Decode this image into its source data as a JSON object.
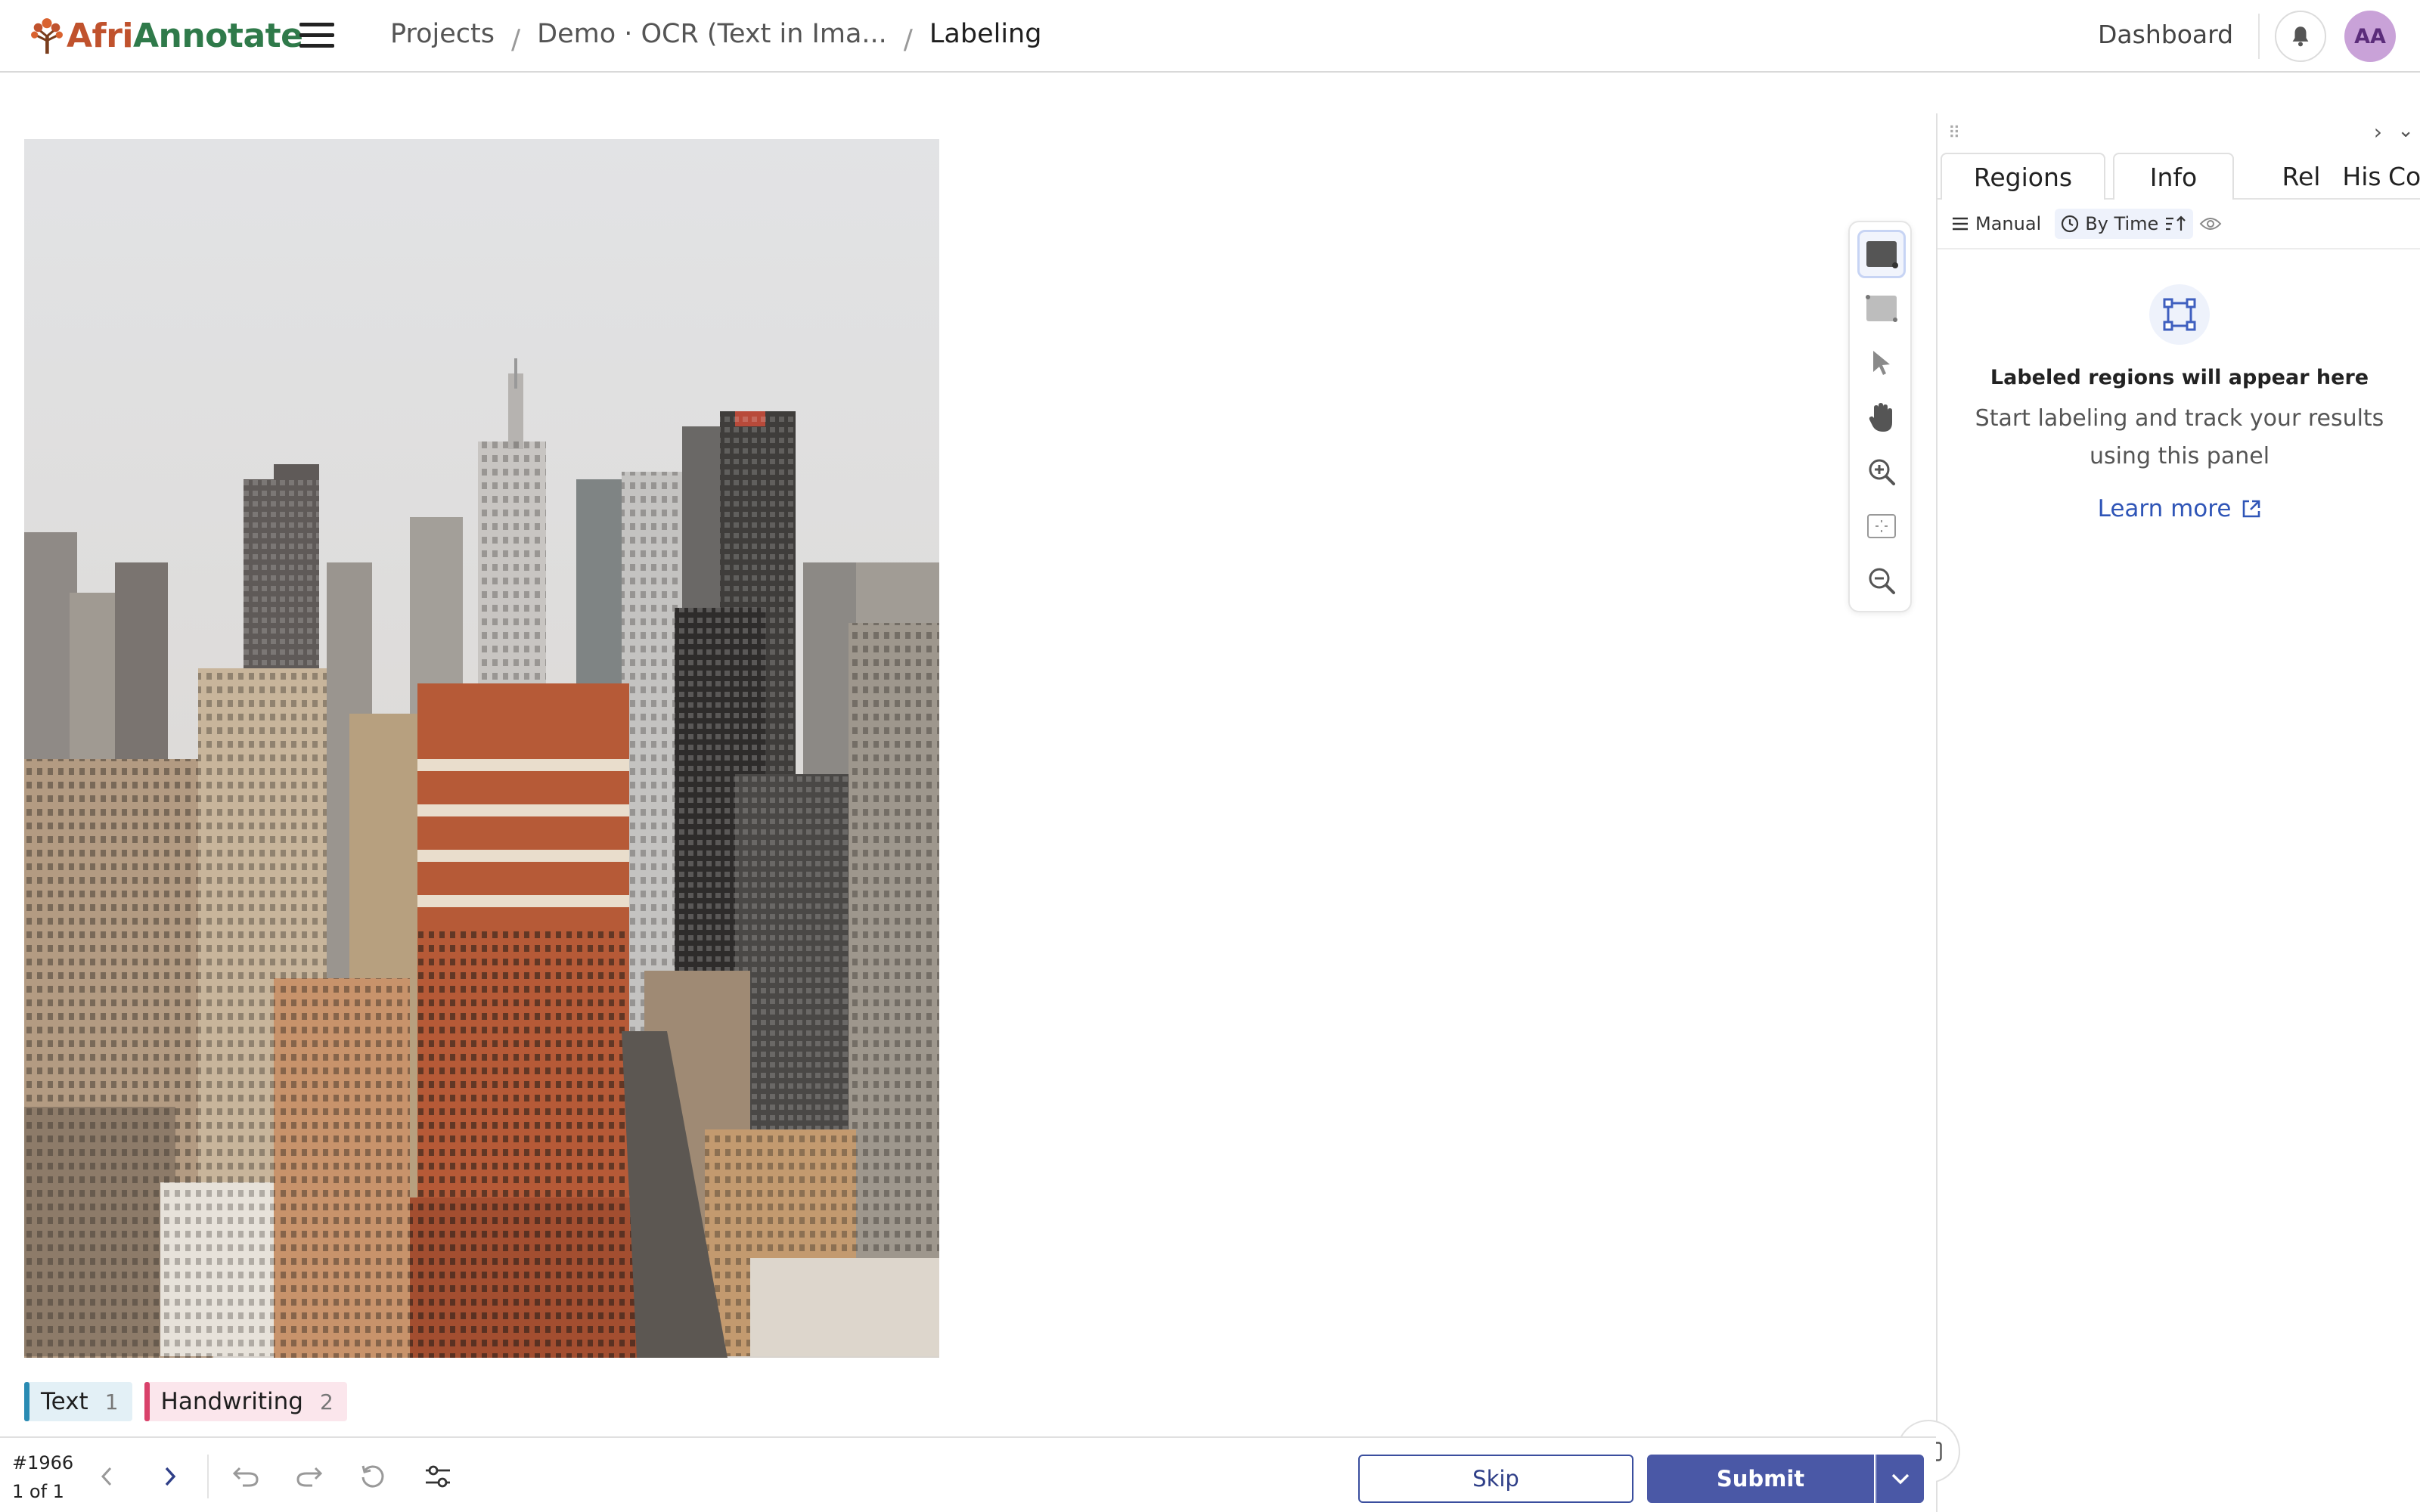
{
  "header": {
    "logo_afri": "Afri",
    "logo_annotate": "Annotate",
    "breadcrumb": [
      "Projects",
      "Demo · OCR (Text in Ima...",
      "Labeling"
    ],
    "dashboard": "Dashboard",
    "avatar_initials": "AA"
  },
  "toolbar": {
    "tools": [
      "rectangle-fill-icon",
      "rectangle-icon",
      "select-pointer-icon",
      "pan-hand-icon",
      "zoom-in-icon",
      "zoom-to-fit-icon",
      "zoom-out-icon"
    ],
    "active_tool": "rectangle-fill-icon"
  },
  "labels": [
    {
      "name": "Text",
      "hotkey": "1",
      "color": "#2a8bb3"
    },
    {
      "name": "Handwriting",
      "hotkey": "2",
      "color": "#d9426b"
    }
  ],
  "panel": {
    "tabs": [
      "Regions",
      "Info",
      "Rel",
      "His",
      "Co"
    ],
    "filters": {
      "manual": "Manual",
      "by_time": "By Time"
    },
    "empty_title": "Labeled regions will appear here",
    "empty_subtitle": "Start labeling and track your results using this panel",
    "learn_more": "Learn more"
  },
  "bottom": {
    "task_id": "#1966",
    "task_pos": "1 of 1",
    "skip": "Skip",
    "submit": "Submit"
  },
  "colors": {
    "accent": "#4a58a6",
    "link": "#2f55b7"
  }
}
